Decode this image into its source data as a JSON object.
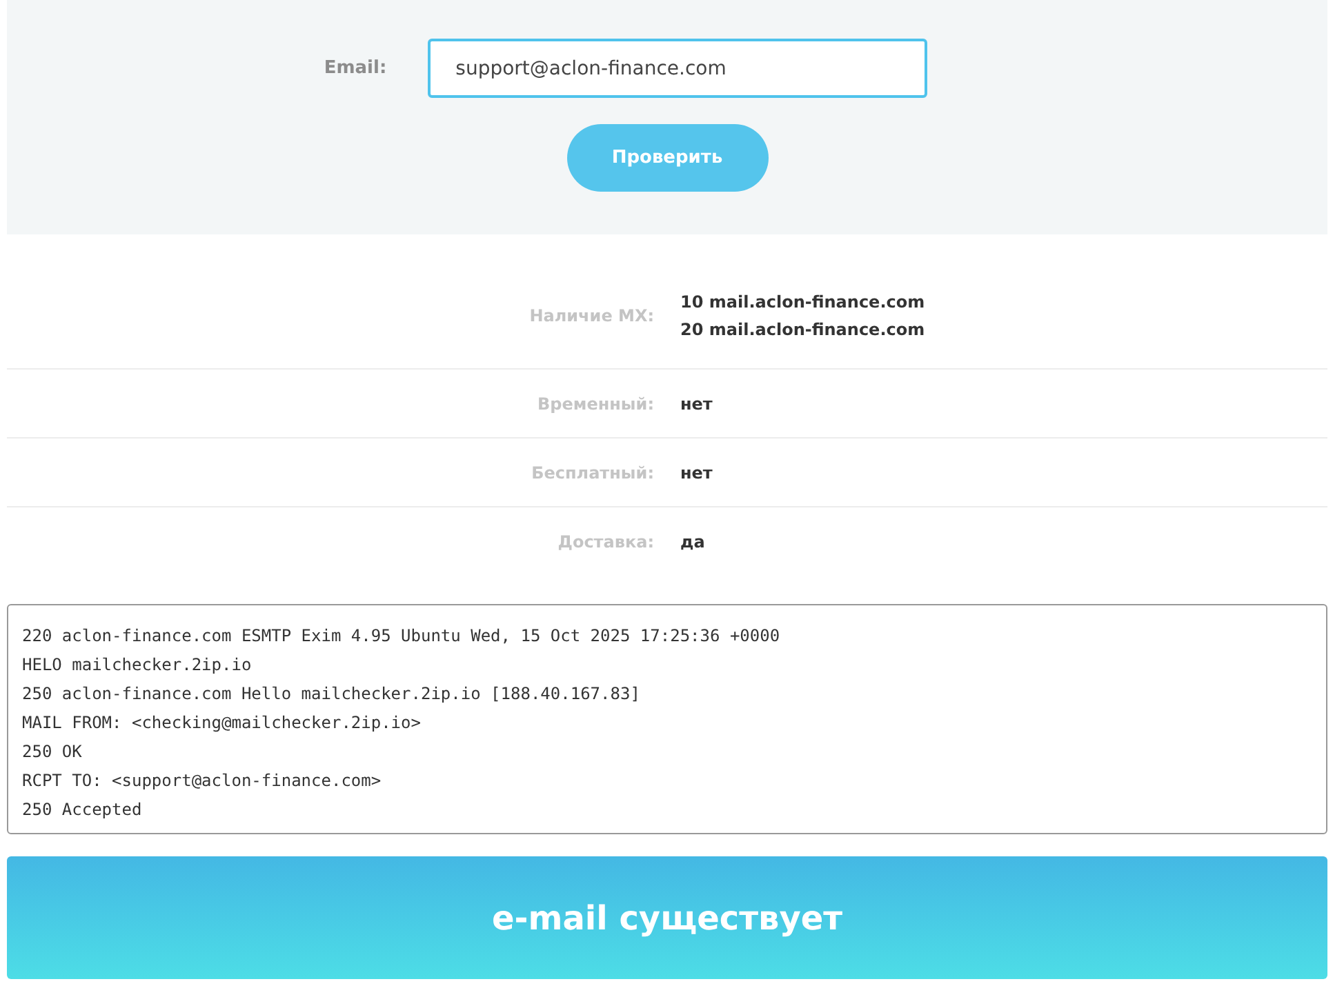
{
  "form": {
    "label": "Email:",
    "value": "support@aclon-finance.com",
    "button": "Проверить"
  },
  "results": [
    {
      "label": "Наличие MX:",
      "values": [
        "**10** mail.aclon-finance.com",
        "**20** mail.aclon-finance.com"
      ]
    },
    {
      "label": "Временный:",
      "values": [
        "нет"
      ]
    },
    {
      "label": "Бесплатный:",
      "values": [
        "нет"
      ]
    },
    {
      "label": "Доставка:",
      "values": [
        "да"
      ]
    }
  ],
  "log": [
    "220 aclon-finance.com ESMTP Exim 4.95 Ubuntu Wed, 15 Oct 2025 17:25:36 +0000",
    "HELO mailchecker.2ip.io",
    "250 aclon-finance.com Hello mailchecker.2ip.io [188.40.167.83]",
    "MAIL FROM: <checking@mailchecker.2ip.io>",
    "250 OK",
    "RCPT TO: <support@aclon-finance.com>",
    "250 Accepted"
  ],
  "verdict": "e-mail существует"
}
